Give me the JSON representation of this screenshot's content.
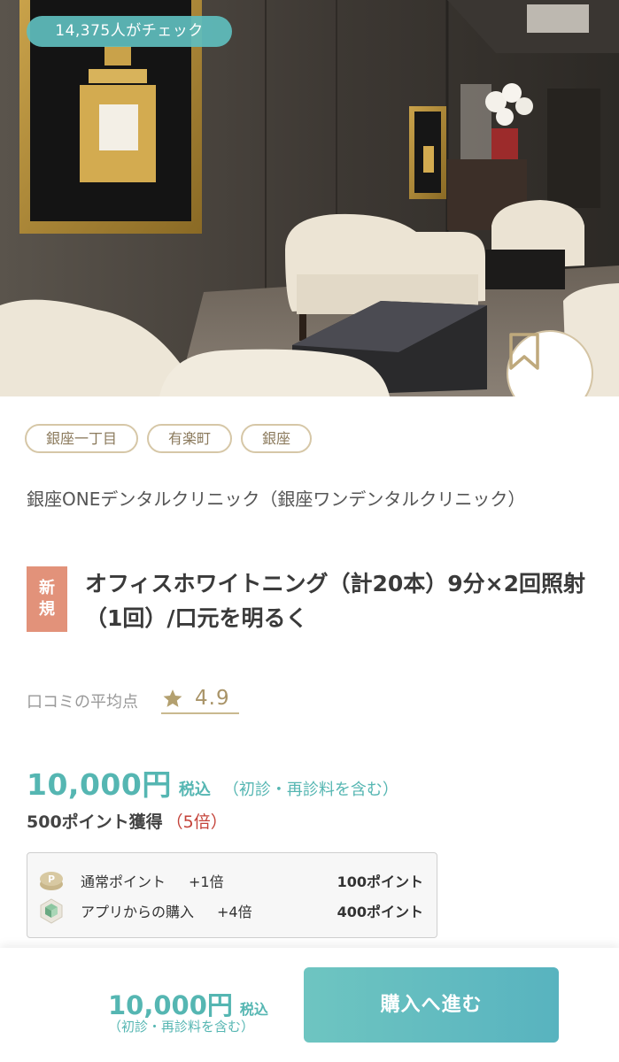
{
  "hero": {
    "check_count_text": "14,375人がチェック",
    "icons": {
      "bookmark": "bookmark-icon"
    }
  },
  "tags": [
    "銀座一丁目",
    "有楽町",
    "銀座"
  ],
  "clinic": {
    "name": "銀座ONEデンタルクリニック（銀座ワンデンタルクリニック）"
  },
  "product": {
    "badge": "新規",
    "title": "オフィスホワイトニング（計20本）9分×2回照射（1回）/口元を明るく"
  },
  "rating": {
    "label": "口コミの平均点",
    "value": "4.9",
    "icon": "star-icon"
  },
  "price": {
    "amount": "10,000円",
    "tax_label": "税込",
    "note": "（初診・再診料を含む）"
  },
  "points": {
    "total_text": "500ポイント獲得",
    "multiplier_text": "（5倍）",
    "rows": [
      {
        "icon": "point-coin-icon",
        "label": "通常ポイント",
        "multiplier": "+1倍",
        "amount": "100ポイント"
      },
      {
        "icon": "app-icon",
        "label": "アプリからの購入",
        "multiplier": "+4倍",
        "amount": "400ポイント"
      }
    ]
  },
  "footer": {
    "price": "10,000円",
    "tax_label": "税込",
    "note": "（初診・再診料を含む）",
    "buy_label": "購入へ進む"
  },
  "colors": {
    "accent_teal": "#55b6b2",
    "gold": "#a99468",
    "new_badge": "#e2927a",
    "multiplier_red": "#c4433a"
  }
}
